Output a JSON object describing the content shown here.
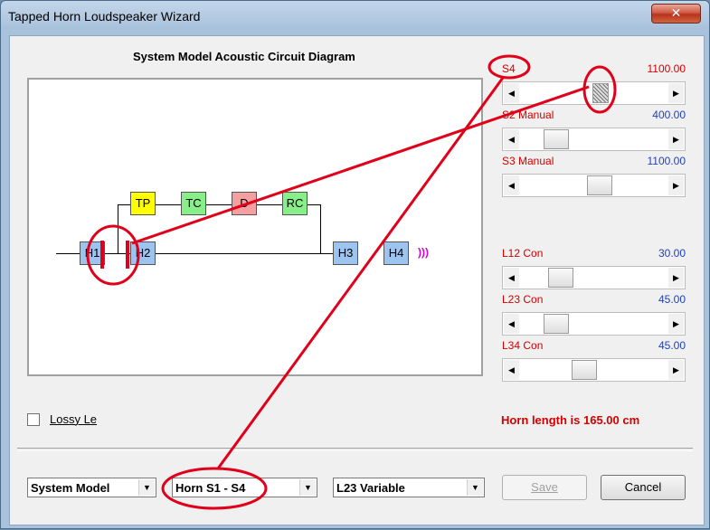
{
  "window": {
    "title": "Tapped Horn Loudspeaker Wizard",
    "close_symbol": "✕"
  },
  "diagram": {
    "title": "System Model Acoustic Circuit Diagram",
    "blocks": {
      "tp": "TP",
      "tc": "TC",
      "d": "D",
      "rc": "RC",
      "h1": "H1",
      "h2": "H2",
      "h3": "H3",
      "h4": "H4"
    },
    "sound_glyph": ")))"
  },
  "sliders": [
    {
      "label": "S4",
      "value": "1100.00",
      "label_color": "#d40000",
      "value_color": "#d40000",
      "position": 0.55,
      "hatched": true
    },
    {
      "label": "S2 Manual",
      "value": "400.00",
      "label_color": "#d40000",
      "value_color": "#1f3fbf",
      "position": 0.2
    },
    {
      "label": "S3 Manual",
      "value": "1100.00",
      "label_color": "#d40000",
      "value_color": "#1f3fbf",
      "position": 0.55
    },
    {
      "label": "L12 Con",
      "value": "30.00",
      "label_color": "#d40000",
      "value_color": "#1f3fbf",
      "position": 0.23
    },
    {
      "label": "L23 Con",
      "value": "45.00",
      "label_color": "#d40000",
      "value_color": "#1f3fbf",
      "position": 0.2
    },
    {
      "label": "L34 Con",
      "value": "45.00",
      "label_color": "#d40000",
      "value_color": "#1f3fbf",
      "position": 0.42
    }
  ],
  "lossy": {
    "label": "Lossy Le",
    "checked": false
  },
  "horn_length": "Horn length is 165.00 cm",
  "dropdowns": {
    "system_model": "System Model",
    "horn_section": "Horn S1 - S4",
    "variable": "L23 Variable",
    "arrow": "▼"
  },
  "buttons": {
    "save": "Save",
    "cancel": "Cancel"
  },
  "colors": {
    "tp": "#ffff00",
    "tc": "#88ee88",
    "d": "#f4a0a0",
    "rc": "#88ee88",
    "h": "#9cc4ee",
    "annotation": "#e0001a",
    "sound": "#d400d4"
  }
}
